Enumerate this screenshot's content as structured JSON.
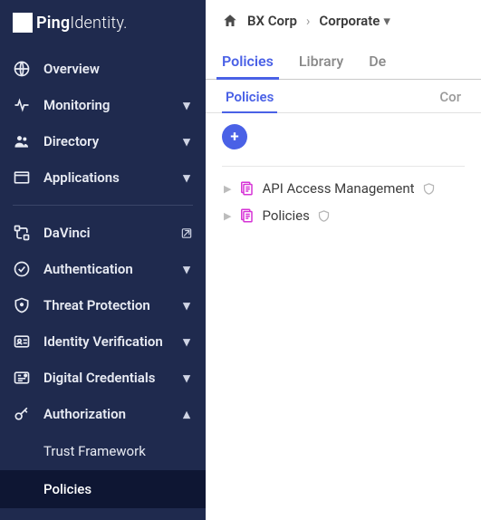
{
  "brand": {
    "name": "PingIdentity."
  },
  "sidebar": {
    "overview": "Overview",
    "monitoring": "Monitoring",
    "directory": "Directory",
    "applications": "Applications",
    "davinci": "DaVinci",
    "authentication": "Authentication",
    "threat": "Threat Protection",
    "identity": "Identity Verification",
    "digital": "Digital Credentials",
    "authorization": "Authorization",
    "sub": {
      "trust": "Trust Framework",
      "policies": "Policies"
    }
  },
  "breadcrumb": {
    "org": "BX Corp",
    "env": "Corporate"
  },
  "tabsOuter": {
    "policies": "Policies",
    "library": "Library",
    "decisions": "De"
  },
  "tabsInner": {
    "policies": "Policies",
    "config": "Cor"
  },
  "tree": {
    "item1": "API Access Management",
    "item2": "Policies"
  },
  "colors": {
    "accent": "#4a61e6",
    "magenta": "#d633d6"
  }
}
